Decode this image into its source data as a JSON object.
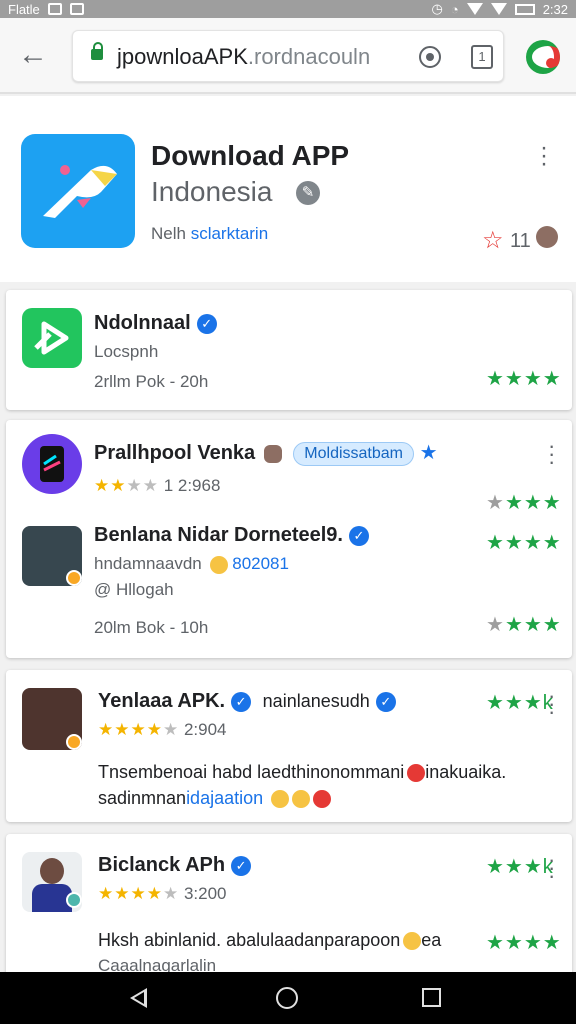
{
  "status": {
    "carrier": "Flatle",
    "time": "2:32"
  },
  "browser": {
    "url_main": "jpownloaAPK",
    "url_rest": ".rordnacouln",
    "tab_count": "1"
  },
  "header": {
    "title": "Download APP",
    "subtitle": "Indonesia",
    "meta_prefix": "Nelh",
    "meta_link": "sclarktarin",
    "rating": "11"
  },
  "cards": [
    {
      "title": "Ndolnnaal",
      "line1": "Locspnh",
      "line2": "2rllm Pok - 20h",
      "stars": "★★★★"
    },
    {
      "rows": [
        {
          "title": "Prallhpool Venka",
          "chip": "Moldissatbam",
          "meta": "1 2:968",
          "stars": "★★★★"
        },
        {
          "title": "Benlana Nidar Dorneteel9.",
          "line1": "hndamnaavdn",
          "line1_blue": "802081",
          "line2": "@ Hllogah",
          "line3": "20lm Bok - 10h",
          "stars_a": "★★★★",
          "stars_b": "★★★★"
        }
      ]
    },
    {
      "title": "Yenlaaa APK.",
      "title_b": "nainlanesudh",
      "meta": "2:904",
      "body": "Tnsembenoai habd laedthinonommani",
      "body_tail": "inakuaika.",
      "body2": "sadinmnan",
      "body2_blue": "idajaation",
      "stars": "★★★k"
    },
    {
      "title": "Biclanck APh",
      "meta": "3:200",
      "body": "Hksh abinlanid. abalulaadanparapoon",
      "body_tail": "ea",
      "body2": "Caaalnagarlalin",
      "stars": "★★★k",
      "stars_b": "★★★★"
    }
  ]
}
